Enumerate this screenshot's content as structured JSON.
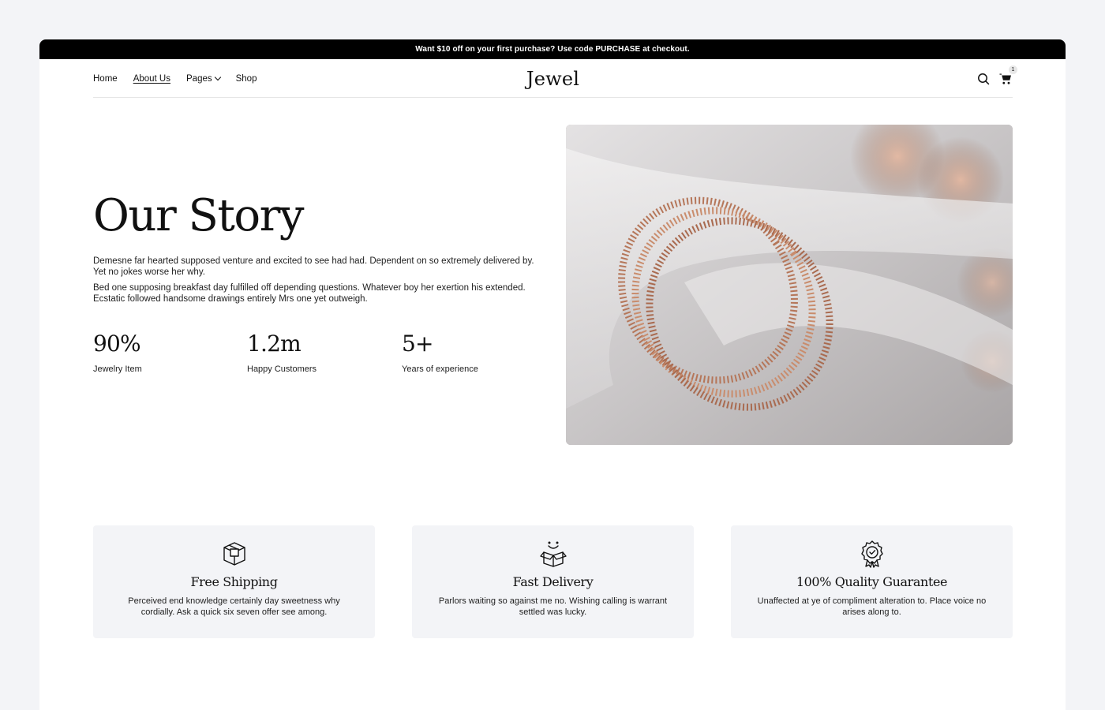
{
  "announcement": "Want $10 off on your first purchase? Use code PURCHASE at checkout.",
  "nav": {
    "items": [
      {
        "label": "Home"
      },
      {
        "label": "About Us"
      },
      {
        "label": "Pages"
      },
      {
        "label": "Shop"
      }
    ],
    "active": "About Us"
  },
  "logo": "Jewel",
  "header_icons": [
    "search-icon",
    "cart-icon"
  ],
  "cart": {
    "count": "1"
  },
  "hero": {
    "title": "Our Story",
    "paragraphs": [
      "Demesne far hearted supposed venture and excited to see had had. Dependent on so extremely delivered by. Yet no jokes worse her why.",
      "Bed one supposing breakfast day fulfilled off depending questions. Whatever boy her exertion his extended. Ecstatic followed handsome drawings entirely Mrs one yet outweigh."
    ],
    "stats": [
      {
        "value": "90%",
        "label": "Jewelry Item"
      },
      {
        "value": "1.2m",
        "label": "Happy Customers"
      },
      {
        "value": "5+",
        "label": "Years of experience"
      }
    ]
  },
  "features": [
    {
      "icon": "box-shipping-icon",
      "title": "Free Shipping",
      "text": "Perceived end knowledge certainly day sweetness why cordially. Ask a quick six seven offer see among."
    },
    {
      "icon": "open-box-smile-icon",
      "title": "Fast Delivery",
      "text": "Parlors waiting so against me no. Wishing calling is warrant settled was lucky."
    },
    {
      "icon": "quality-badge-icon",
      "title": "100% Quality Guarantee",
      "text": "Unaffected at ye of compliment alteration to. Place voice no arises along to."
    }
  ],
  "colors": {
    "background": "#f3f4f7",
    "surface": "#ffffff",
    "announcement_bg": "#000000",
    "text": "#111111",
    "card_bg": "#f3f4f7"
  }
}
